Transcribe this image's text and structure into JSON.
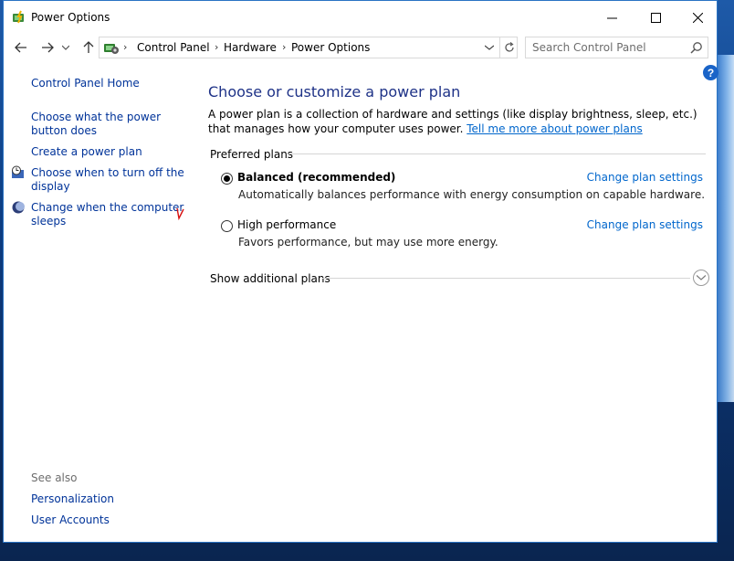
{
  "window": {
    "title": "Power Options",
    "caption": {
      "minimize": "minimize-icon",
      "maximize": "maximize-icon",
      "close": "close-icon"
    }
  },
  "address_bar": {
    "crumbs": [
      "Control Panel",
      "Hardware",
      "Power Options"
    ]
  },
  "search": {
    "placeholder": "Search Control Panel"
  },
  "sidebar": {
    "home": "Control Panel Home",
    "items": [
      {
        "label": "Choose what the power button does",
        "icon": ""
      },
      {
        "label": "Create a power plan",
        "icon": ""
      },
      {
        "label": "Choose when to turn off the display",
        "icon": "clock-display-icon"
      },
      {
        "label": "Change when the computer sleeps",
        "icon": "moon-sleep-icon"
      }
    ],
    "see_also_title": "See also",
    "see_also": [
      "Personalization",
      "User Accounts"
    ]
  },
  "main": {
    "heading": "Choose or customize a power plan",
    "description": "A power plan is a collection of hardware and settings (like display brightness, sleep, etc.) that manages how your computer uses power. ",
    "description_link": "Tell me more about power plans",
    "preferred_plans_label": "Preferred plans",
    "plans": [
      {
        "name": "Balanced (recommended)",
        "selected": true,
        "description": "Automatically balances performance with energy consumption on capable hardware.",
        "change_label": "Change plan settings"
      },
      {
        "name": "High performance",
        "selected": false,
        "description": "Favors performance, but may use more energy.",
        "change_label": "Change plan settings"
      }
    ],
    "additional_plans_label": "Show additional plans"
  },
  "colors": {
    "link": "#0066cc",
    "heading": "#1e3287",
    "help": "#1a64c8"
  }
}
